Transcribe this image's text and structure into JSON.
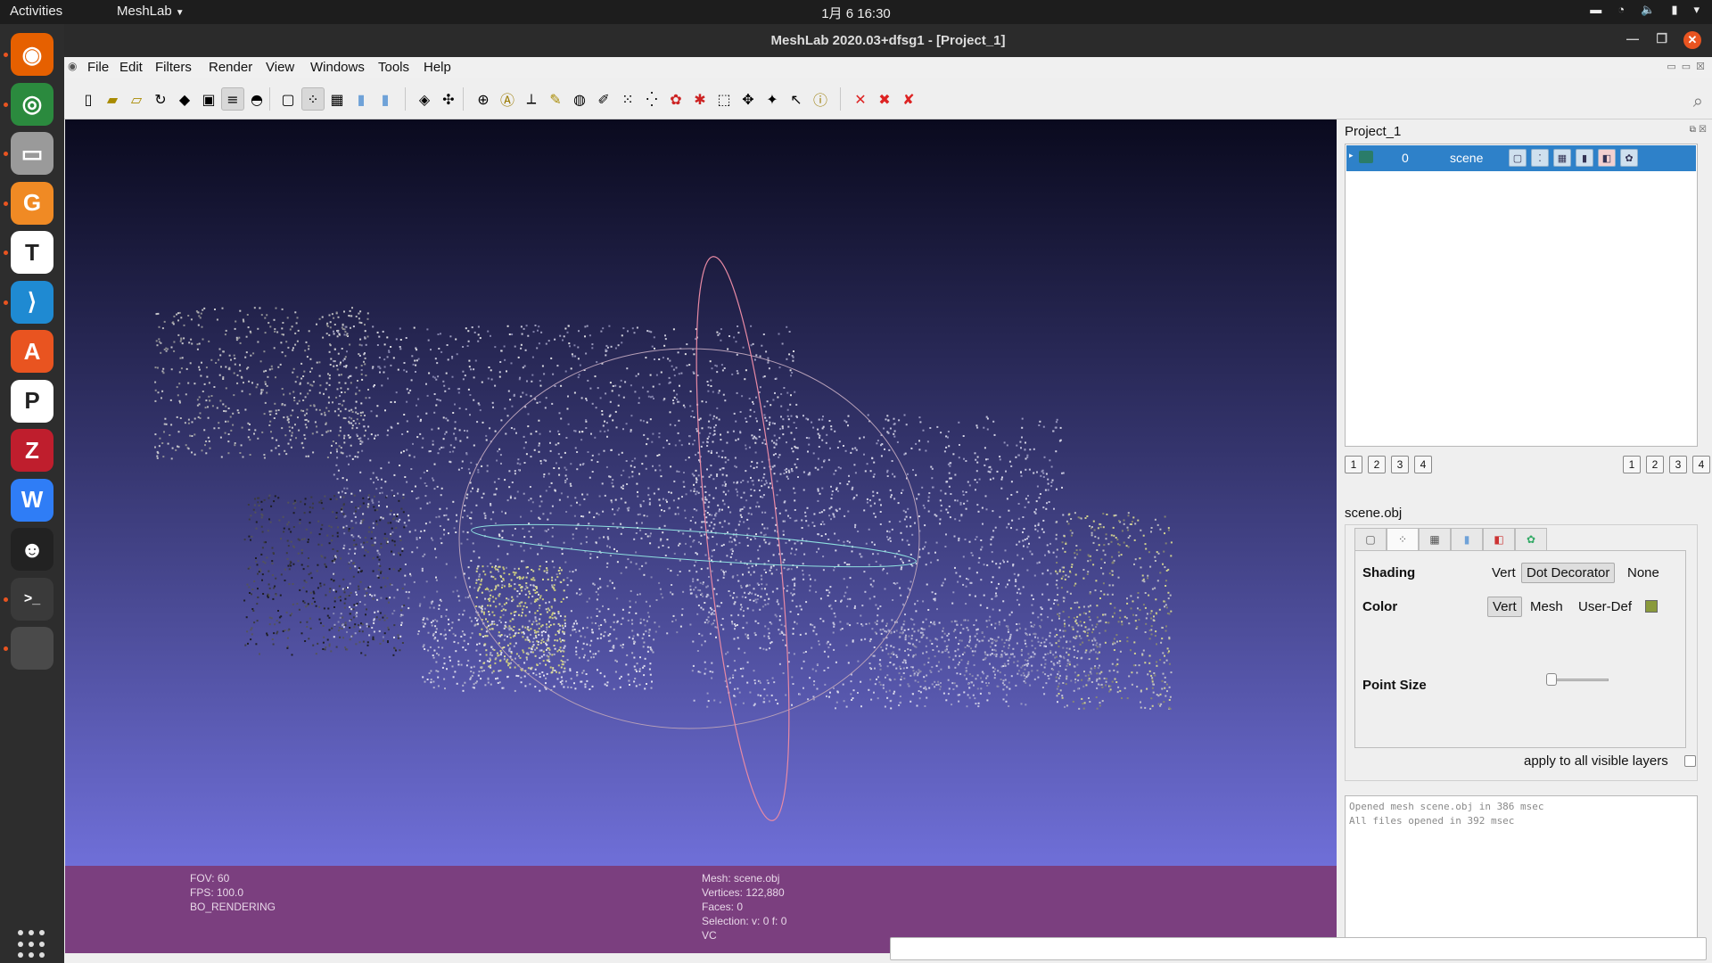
{
  "topbar": {
    "activities": "Activities",
    "app_menu": "MeshLab",
    "clock": "1月 6  16:30"
  },
  "dock": {
    "items": [
      {
        "name": "firefox",
        "icon": "firefox-icon",
        "color": "#e66000"
      },
      {
        "name": "chrome",
        "icon": "chrome-icon",
        "color": "#2b8a3e"
      },
      {
        "name": "files",
        "icon": "files-icon",
        "color": "#9a9a9a"
      },
      {
        "name": "pdf",
        "icon": "pdf-editor-icon",
        "color": "#f08a24"
      },
      {
        "name": "typora",
        "icon": "text-editor-icon",
        "color": "#ffffff"
      },
      {
        "name": "vscode",
        "icon": "vscode-icon",
        "color": "#1f8ad2"
      },
      {
        "name": "software",
        "icon": "software-center-icon",
        "color": "#e95420"
      },
      {
        "name": "wps-presentation",
        "icon": "presentation-icon",
        "color": "#ffffff"
      },
      {
        "name": "filezilla",
        "icon": "filezilla-icon",
        "color": "#bf1e2d"
      },
      {
        "name": "wps-writer",
        "icon": "writer-icon",
        "color": "#2f7df6"
      },
      {
        "name": "qq",
        "icon": "qq-penguin-icon",
        "color": "#222222"
      },
      {
        "name": "terminal",
        "icon": "terminal-icon",
        "color": "#3a3a3a"
      },
      {
        "name": "meshlab",
        "icon": "meshlab-icon",
        "color": "#4a4a4a"
      }
    ]
  },
  "window": {
    "title": "MeshLab 2020.03+dfsg1 - [Project_1]"
  },
  "menu": {
    "items": [
      "File",
      "Edit",
      "Filters",
      "Render",
      "View",
      "Windows",
      "Tools",
      "Help"
    ]
  },
  "toolbar": {
    "tools": [
      "new-project-icon",
      "open-project-icon",
      "import-mesh-icon",
      "reload-icon",
      "export-mesh-icon",
      "snapshot-icon",
      "layers-icon",
      "light-icon",
      "bounding-box-icon",
      "points-icon",
      "wireframe-icon",
      "flat-lines-icon",
      "smooth-icon",
      "texture-icon",
      "axis-icon",
      "trackball-icon",
      "annotate-icon",
      "measure-icon",
      "align-icon",
      "raster-icon",
      "paint-icon",
      "select-vertices-icon",
      "select-faces-icon",
      "color-icon",
      "georef-icon",
      "select-region-icon",
      "select-connected-icon",
      "pick-points-icon",
      "z-painting-icon",
      "info-icon",
      "delete-vertices-icon",
      "delete-faces-icon",
      "delete-all-icon"
    ]
  },
  "viewport": {
    "info_left": [
      "FOV: 60",
      "FPS:   100.0",
      "BO_RENDERING"
    ],
    "info_right": [
      "Mesh: scene.obj",
      "Vertices: 122,880",
      "Faces: 0",
      "Selection: v: 0 f: 0",
      "VC"
    ],
    "bg_top": "#0a0a1e",
    "bg_bottom": "#6f6fd8",
    "info_bg": "#7b3f7f"
  },
  "panel": {
    "title": "Project_1",
    "layer": {
      "number": "0",
      "name": "scene"
    },
    "left_nums": [
      "1",
      "2",
      "3",
      "4"
    ],
    "right_nums": [
      "1",
      "2",
      "3",
      "4"
    ],
    "mesh_name": "scene.obj",
    "shading_label": "Shading",
    "shading_options": [
      "Vert",
      "Dot Decorator",
      "None"
    ],
    "shading_selected": "Dot Decorator",
    "color_label": "Color",
    "color_options": [
      "Vert",
      "Mesh",
      "User-Def"
    ],
    "color_selected": "Vert",
    "user_color": "#8a9a3c",
    "point_size_label": "Point Size",
    "apply_label": "apply to all visible layers",
    "log": [
      "Opened mesh scene.obj in 386 msec",
      "All files opened in 392 msec"
    ]
  }
}
